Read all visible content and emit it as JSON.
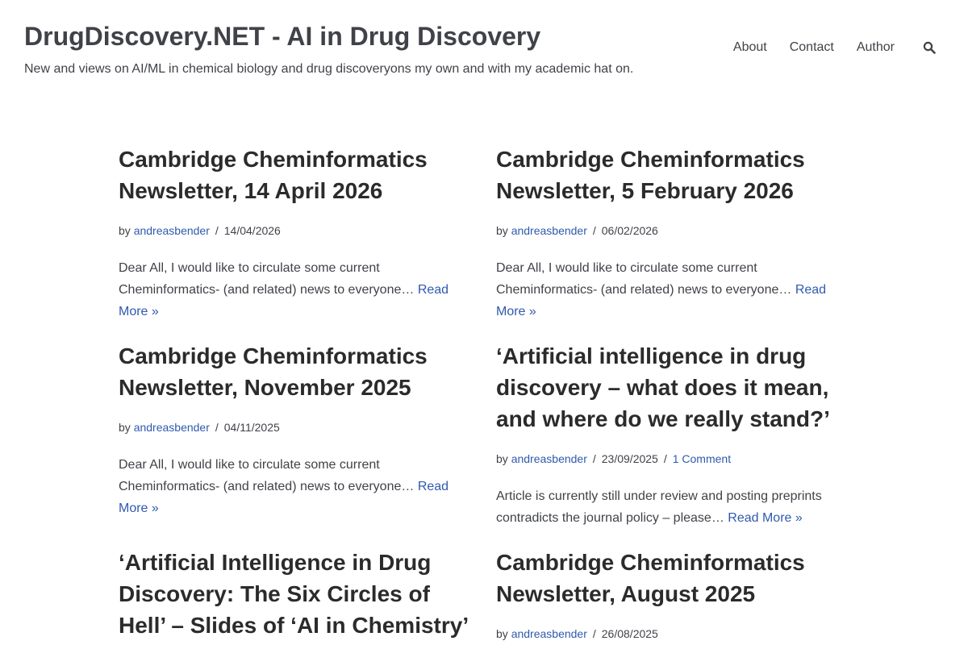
{
  "header": {
    "site_title": "DrugDiscovery.NET - AI in Drug Discovery",
    "tagline": "New and views on AI/ML in chemical biology and drug discoveryons my own and with my academic hat on.",
    "nav": [
      "About",
      "Contact",
      "Author"
    ],
    "search_icon": "search-icon"
  },
  "labels": {
    "by": "by",
    "separator": "/",
    "read_more": "Read More »",
    "ellipsis": "…"
  },
  "posts": [
    {
      "title": "Cambridge Cheminformatics Newsletter, 14 April 2026",
      "author": "andreasbender",
      "date": "14/04/2026",
      "excerpt": "Dear All, I would like to circulate some current Cheminformatics- (and related) news to everyone"
    },
    {
      "title": "Cambridge Cheminformatics Newsletter, 5 February 2026",
      "author": "andreasbender",
      "date": "06/02/2026",
      "excerpt": "Dear All, I would like to circulate some current Cheminformatics- (and related) news to everyone"
    },
    {
      "title": "Cambridge Cheminformatics Newsletter, November 2025",
      "author": "andreasbender",
      "date": "04/11/2025",
      "excerpt": "Dear All, I would like to circulate some current Cheminformatics- (and related) news to everyone"
    },
    {
      "title": "‘Artificial intelligence in drug discovery – what does it mean, and where do we really stand?’",
      "author": "andreasbender",
      "date": "23/09/2025",
      "comments": "1 Comment",
      "excerpt": "Article is currently still under review and posting preprints contradicts the journal policy – please"
    },
    {
      "title": "‘Artificial Intelligence in Drug Discovery: The Six Circles of Hell’ – Slides of ‘AI in Chemistry’",
      "author": "",
      "date": "",
      "excerpt": ""
    },
    {
      "title": "Cambridge Cheminformatics Newsletter, August 2025",
      "author": "andreasbender",
      "date": "26/08/2025",
      "excerpt": ""
    }
  ]
}
